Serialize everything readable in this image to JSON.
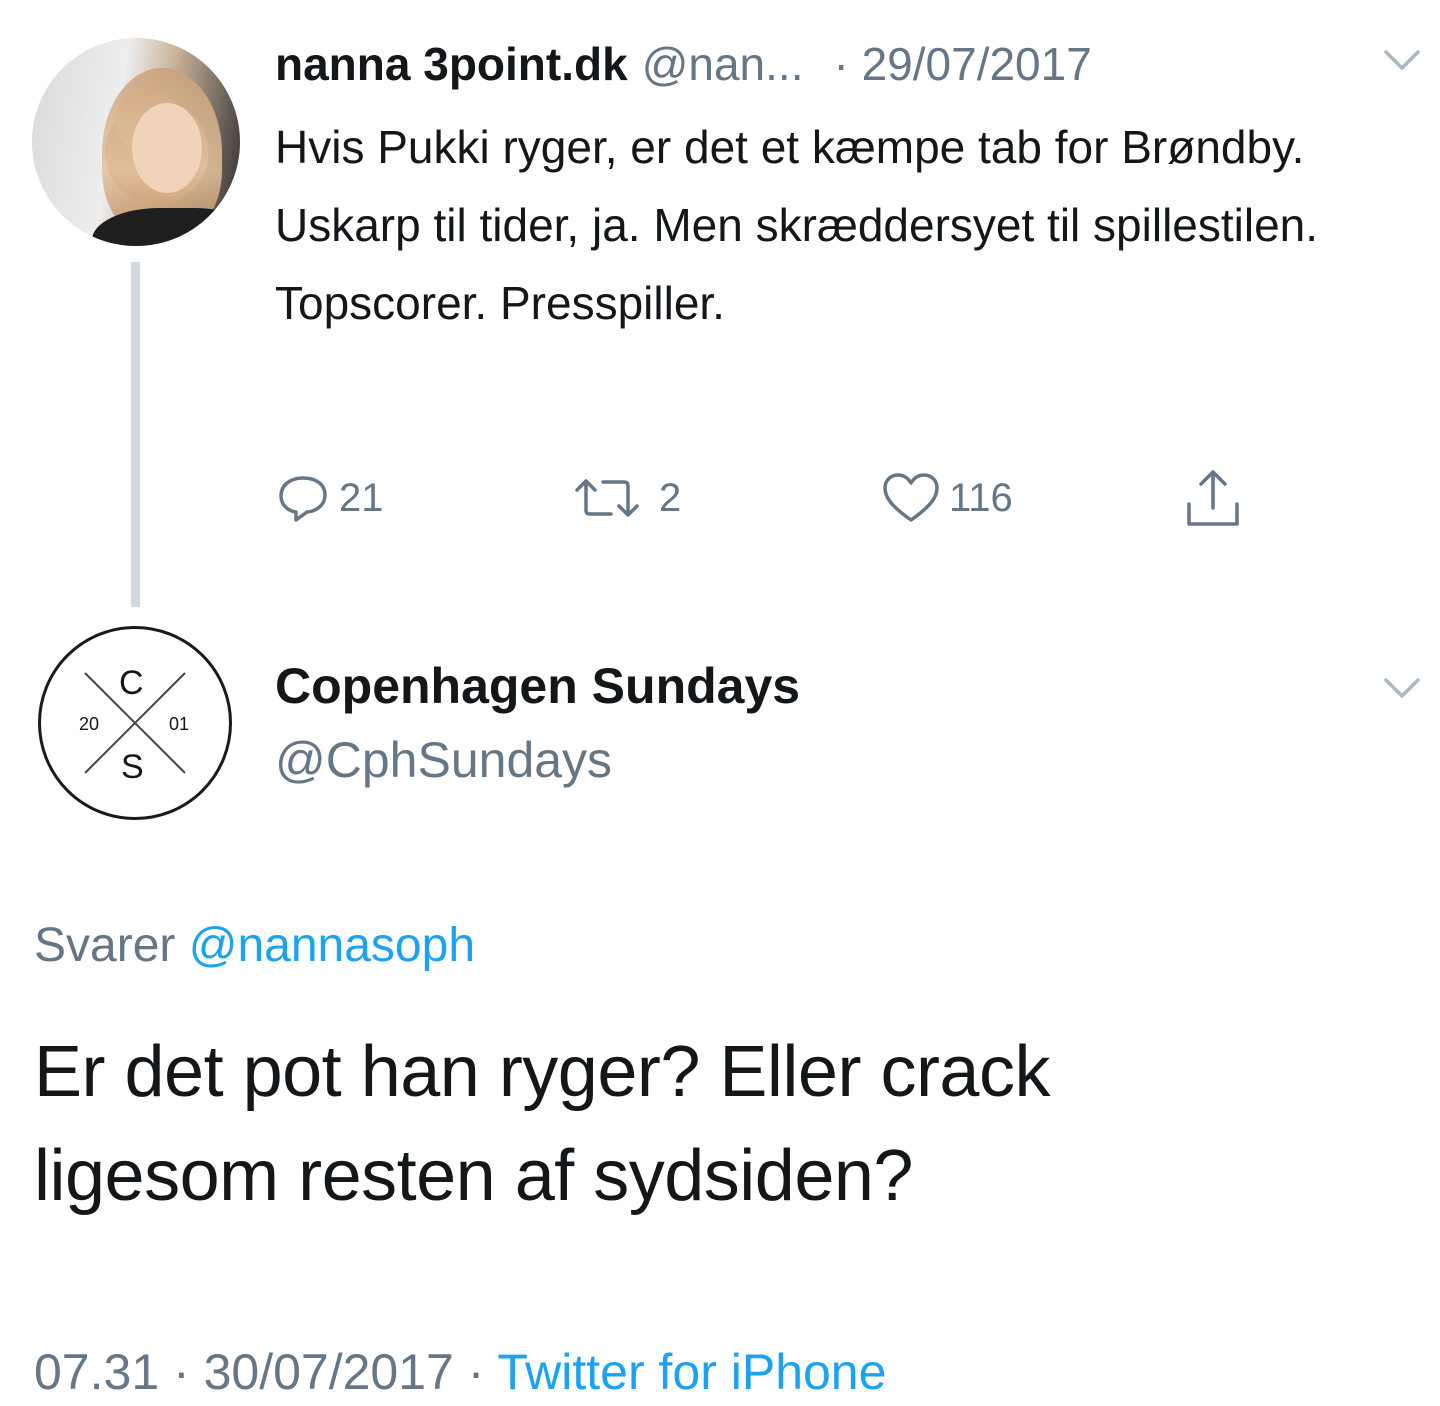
{
  "tweet": {
    "author": "nanna 3point.dk",
    "handle": "@nan...",
    "date": "· 29/07/2017",
    "text": "Hvis Pukki ryger, er det et kæmpe tab for Brøndby. Uskarp til tider, ja. Men skræddersyet til spillestilen. Topscorer. Presspiller.",
    "replies": "21",
    "retweets": "2",
    "likes": "116"
  },
  "reply": {
    "author": "Copenhagen Sundays",
    "handle": "@CphSundays",
    "avatar_logo": {
      "top": "C",
      "bottom": "S",
      "left": "20",
      "right": "01"
    },
    "replying_prefix": "Svarer",
    "replying_to": "@nannasoph",
    "text_line1": "Er det pot han ryger? Eller crack",
    "text_line2": "ligesom resten af sydsiden?",
    "time": "07.31",
    "date": "· 30/07/2017 ·",
    "source": "Twitter for iPhone"
  },
  "icons": {
    "reply": "reply-icon",
    "retweet": "retweet-icon",
    "like": "heart-icon",
    "share": "share-icon",
    "menu": "chevron-down-icon"
  },
  "colors": {
    "text": "#14171a",
    "secondary": "#657786",
    "link": "#1da1f2",
    "thread_line": "#cfd9de"
  }
}
